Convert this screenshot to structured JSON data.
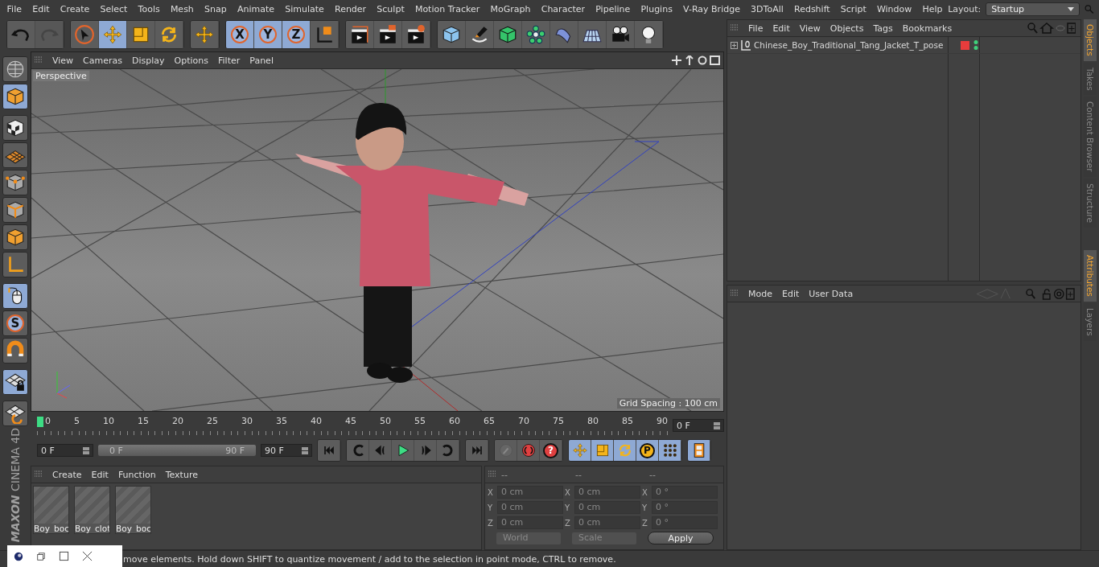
{
  "menubar": {
    "items": [
      "File",
      "Edit",
      "Create",
      "Select",
      "Tools",
      "Mesh",
      "Snap",
      "Animate",
      "Simulate",
      "Render",
      "Sculpt",
      "Motion Tracker",
      "MoGraph",
      "Character",
      "Pipeline",
      "Plugins",
      "V-Ray Bridge",
      "3DToAll",
      "Redshift",
      "Script",
      "Window",
      "Help"
    ],
    "layout_label": "Layout:",
    "layout_value": "Startup"
  },
  "toolbar": [
    {
      "tools": [
        {
          "kind": "undo",
          "disabled": false
        },
        {
          "kind": "redo",
          "disabled": true
        }
      ]
    },
    {
      "tools": [
        {
          "kind": "select",
          "selected": false
        },
        {
          "kind": "move",
          "selected": true
        },
        {
          "kind": "scale",
          "selected": false
        },
        {
          "kind": "rotate",
          "selected": false
        }
      ]
    },
    {
      "tools": [
        {
          "kind": "move"
        }
      ]
    },
    {
      "tools": [
        {
          "kind": "axis",
          "label": "X",
          "selected": true
        },
        {
          "kind": "axis",
          "label": "Y",
          "selected": true
        },
        {
          "kind": "axis",
          "label": "Z",
          "selected": true
        },
        {
          "kind": "coords"
        }
      ]
    },
    {
      "tools": [
        {
          "kind": "render-view"
        },
        {
          "kind": "render"
        },
        {
          "kind": "render-settings"
        }
      ]
    },
    {
      "tools": [
        {
          "kind": "cube"
        },
        {
          "kind": "pen"
        },
        {
          "kind": "subdiv"
        },
        {
          "kind": "cloner"
        },
        {
          "kind": "deformer"
        },
        {
          "kind": "floor"
        },
        {
          "kind": "camera"
        },
        {
          "kind": "light"
        }
      ]
    }
  ],
  "left_tools": [
    {
      "kind": "editable",
      "selected": false
    },
    {
      "kind": "model",
      "selected": true
    },
    {
      "kind": "texture",
      "selected": false
    },
    {
      "kind": "workplane",
      "selected": false
    },
    {
      "kind": "points",
      "selected": false
    },
    {
      "kind": "edges",
      "selected": false
    },
    {
      "kind": "polygons",
      "selected": false
    },
    {
      "kind": "axis-l",
      "selected": false
    },
    {
      "kind": "tweak",
      "selected": true
    },
    {
      "kind": "solo",
      "label": "S",
      "selected": false
    },
    {
      "kind": "magnet",
      "selected": false
    },
    {
      "kind": "grid-lock",
      "selected": true
    },
    {
      "kind": "grid-snap",
      "selected": false
    }
  ],
  "viewport": {
    "menu": [
      "View",
      "Cameras",
      "Display",
      "Options",
      "Filter",
      "Panel"
    ],
    "camera_label": "Perspective",
    "grid_spacing": "Grid Spacing : 100 cm"
  },
  "timeline": {
    "ticks": [
      "0",
      "5",
      "10",
      "15",
      "20",
      "25",
      "30",
      "35",
      "40",
      "45",
      "50",
      "55",
      "60",
      "65",
      "70",
      "75",
      "80",
      "85",
      "90"
    ],
    "level": 0,
    "current_frame": "0 F"
  },
  "playback": {
    "start": "0 F",
    "range_start": "0 F",
    "range_end": "90 F",
    "level": 1,
    "end": "90 F"
  },
  "transport": [
    {
      "tools": [
        {
          "kind": "first"
        }
      ]
    },
    {
      "tools": [
        {
          "kind": "prev-key"
        },
        {
          "kind": "prev-frame"
        },
        {
          "kind": "play"
        },
        {
          "kind": "next-frame"
        },
        {
          "kind": "next-key"
        }
      ]
    },
    {
      "tools": [
        {
          "kind": "last"
        }
      ]
    },
    {
      "tools": [
        {
          "kind": "key-off"
        },
        {
          "kind": "record"
        },
        {
          "kind": "autokey",
          "label": "?"
        }
      ]
    },
    {
      "tools": [
        {
          "kind": "move",
          "selected": true
        },
        {
          "kind": "scale",
          "selected": true
        },
        {
          "kind": "rotate",
          "selected": true
        },
        {
          "kind": "param",
          "label": "P",
          "selected": true
        },
        {
          "kind": "dots",
          "selected": true
        }
      ]
    },
    {
      "tools": [
        {
          "kind": "film",
          "selected": true
        }
      ]
    }
  ],
  "materials": {
    "menu": [
      "Create",
      "Edit",
      "Function",
      "Texture"
    ],
    "items": [
      "Boy_boc",
      "Boy_clot",
      "Boy_boc"
    ]
  },
  "coordinates": {
    "headers": [
      "--",
      "--",
      "--"
    ],
    "rows": [
      {
        "cells": [
          {
            "axis": "X",
            "value": "0 cm"
          },
          {
            "axis": "X",
            "value": "0 cm"
          },
          {
            "axis": "X",
            "value": "0 °"
          }
        ]
      },
      {
        "cells": [
          {
            "axis": "Y",
            "value": "0 cm"
          },
          {
            "axis": "Y",
            "value": "0 cm"
          },
          {
            "axis": "Y",
            "value": "0 °"
          }
        ]
      },
      {
        "cells": [
          {
            "axis": "Z",
            "value": "0 cm"
          },
          {
            "axis": "Z",
            "value": "0 cm"
          },
          {
            "axis": "Z",
            "value": "0 °"
          }
        ]
      }
    ],
    "mode": "World",
    "size_mode": "Scale",
    "apply": "Apply"
  },
  "objects": {
    "menu": [
      "File",
      "Edit",
      "View",
      "Objects",
      "Tags",
      "Bookmarks"
    ],
    "rows": [
      {
        "name": "Chinese_Boy_Traditional_Tang_Jacket_T_pose",
        "expanded": false
      }
    ]
  },
  "attributes": {
    "menu": [
      "Mode",
      "Edit",
      "User Data"
    ]
  },
  "right_tabs_top": [
    {
      "label": "Objects",
      "selected": true
    },
    {
      "label": "Takes",
      "selected": false
    },
    {
      "label": "Content Browser",
      "selected": false
    },
    {
      "label": "Structure",
      "selected": false
    }
  ],
  "right_tabs_bottom": [
    {
      "label": "Attributes",
      "selected": true
    },
    {
      "label": "Layers",
      "selected": false
    }
  ],
  "logo": {
    "brand": "MAXON",
    "product": "CINEMA 4D"
  },
  "status_bar": "move elements. Hold down SHIFT to quantize movement / add to the selection in point mode, CTRL to remove."
}
